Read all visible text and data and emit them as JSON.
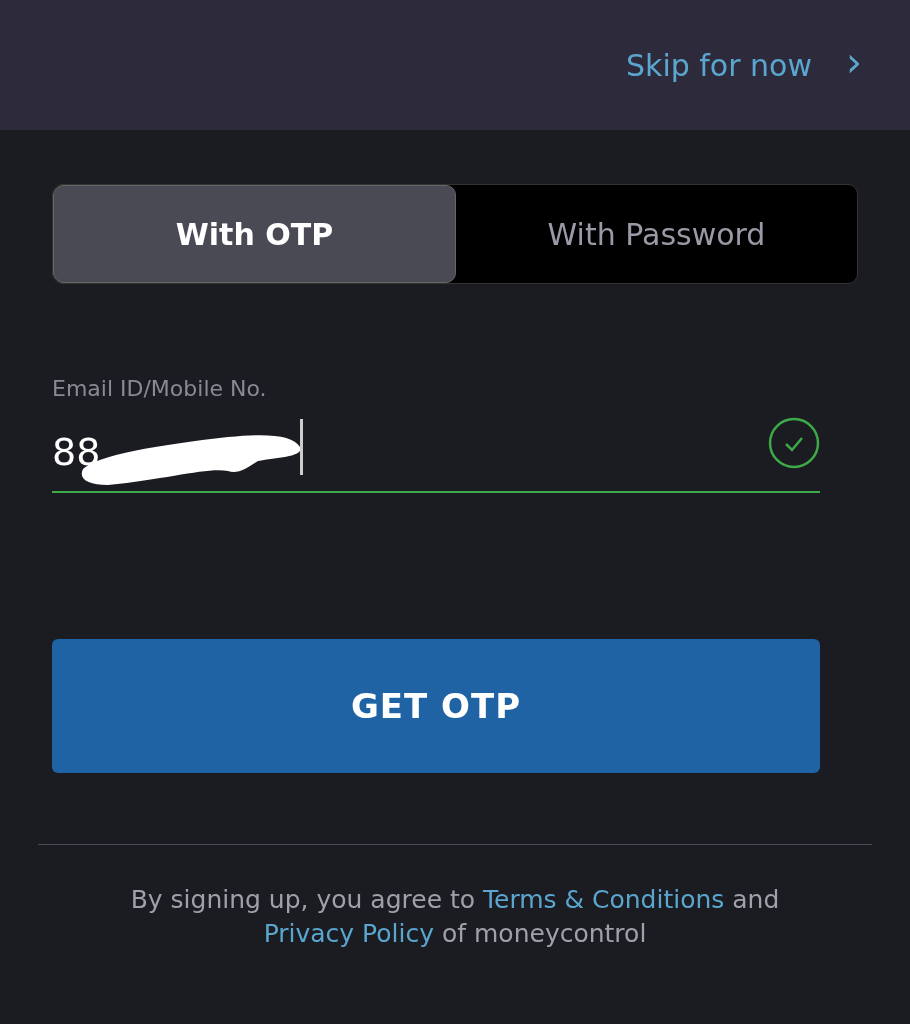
{
  "header": {
    "skip_link": "Skip for now",
    "chevron": "›"
  },
  "tabs": [
    {
      "label": "With OTP",
      "selected": true
    },
    {
      "label": "With Password",
      "selected": false
    }
  ],
  "field": {
    "label": "Email ID/Mobile No.",
    "value": "88",
    "valid": true,
    "focused": true,
    "redacted": true
  },
  "submit_button": "GET OTP",
  "footer": {
    "before": "By signing up, you agree to ",
    "terms_link": "Terms & Conditions",
    "middle": " and ",
    "privacy_link": "Privacy Policy",
    "after": " of moneycontrol"
  }
}
